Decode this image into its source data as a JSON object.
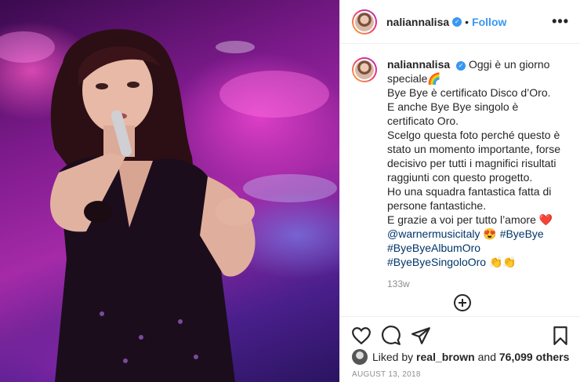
{
  "post": {
    "username": "naliannalisa",
    "follow_label": "Follow",
    "dot": "•",
    "more_label": "•••",
    "verified_mark": "✓"
  },
  "caption": {
    "username": "naliannalisa",
    "lines": [
      "Oggi è un giorno speciale🌈",
      "Bye Bye è certificato Disco d’Oro.",
      "E anche Bye Bye singolo è certificato Oro.",
      "Scelgo questa foto perché questo è stato un momento importante, forse decisivo per tutti i magnifici risultati raggiunti con questo progetto.",
      "Ho una squadra fantastica fatta di persone fantastiche.",
      "E grazie a voi per tutto l’amore ❤️"
    ],
    "mention": "@warnermusicitaly",
    "emoji_smile": "😍",
    "tag_1": "#ByeBye",
    "tag_2": "#ByeByeAlbumOro",
    "tag_3": "#ByeByeSingoloOro",
    "emoji_hands": "👏👏",
    "time_ago": "133w"
  },
  "likes": {
    "prefix": "Liked by",
    "user": "real_brown",
    "and": "and",
    "others": "76,099 others"
  },
  "date": "AUGUST 13, 2018",
  "icons": [
    "heart-icon",
    "comment-icon",
    "share-icon",
    "bookmark-icon",
    "add-comment-icon",
    "more-icon",
    "verified-icon"
  ]
}
